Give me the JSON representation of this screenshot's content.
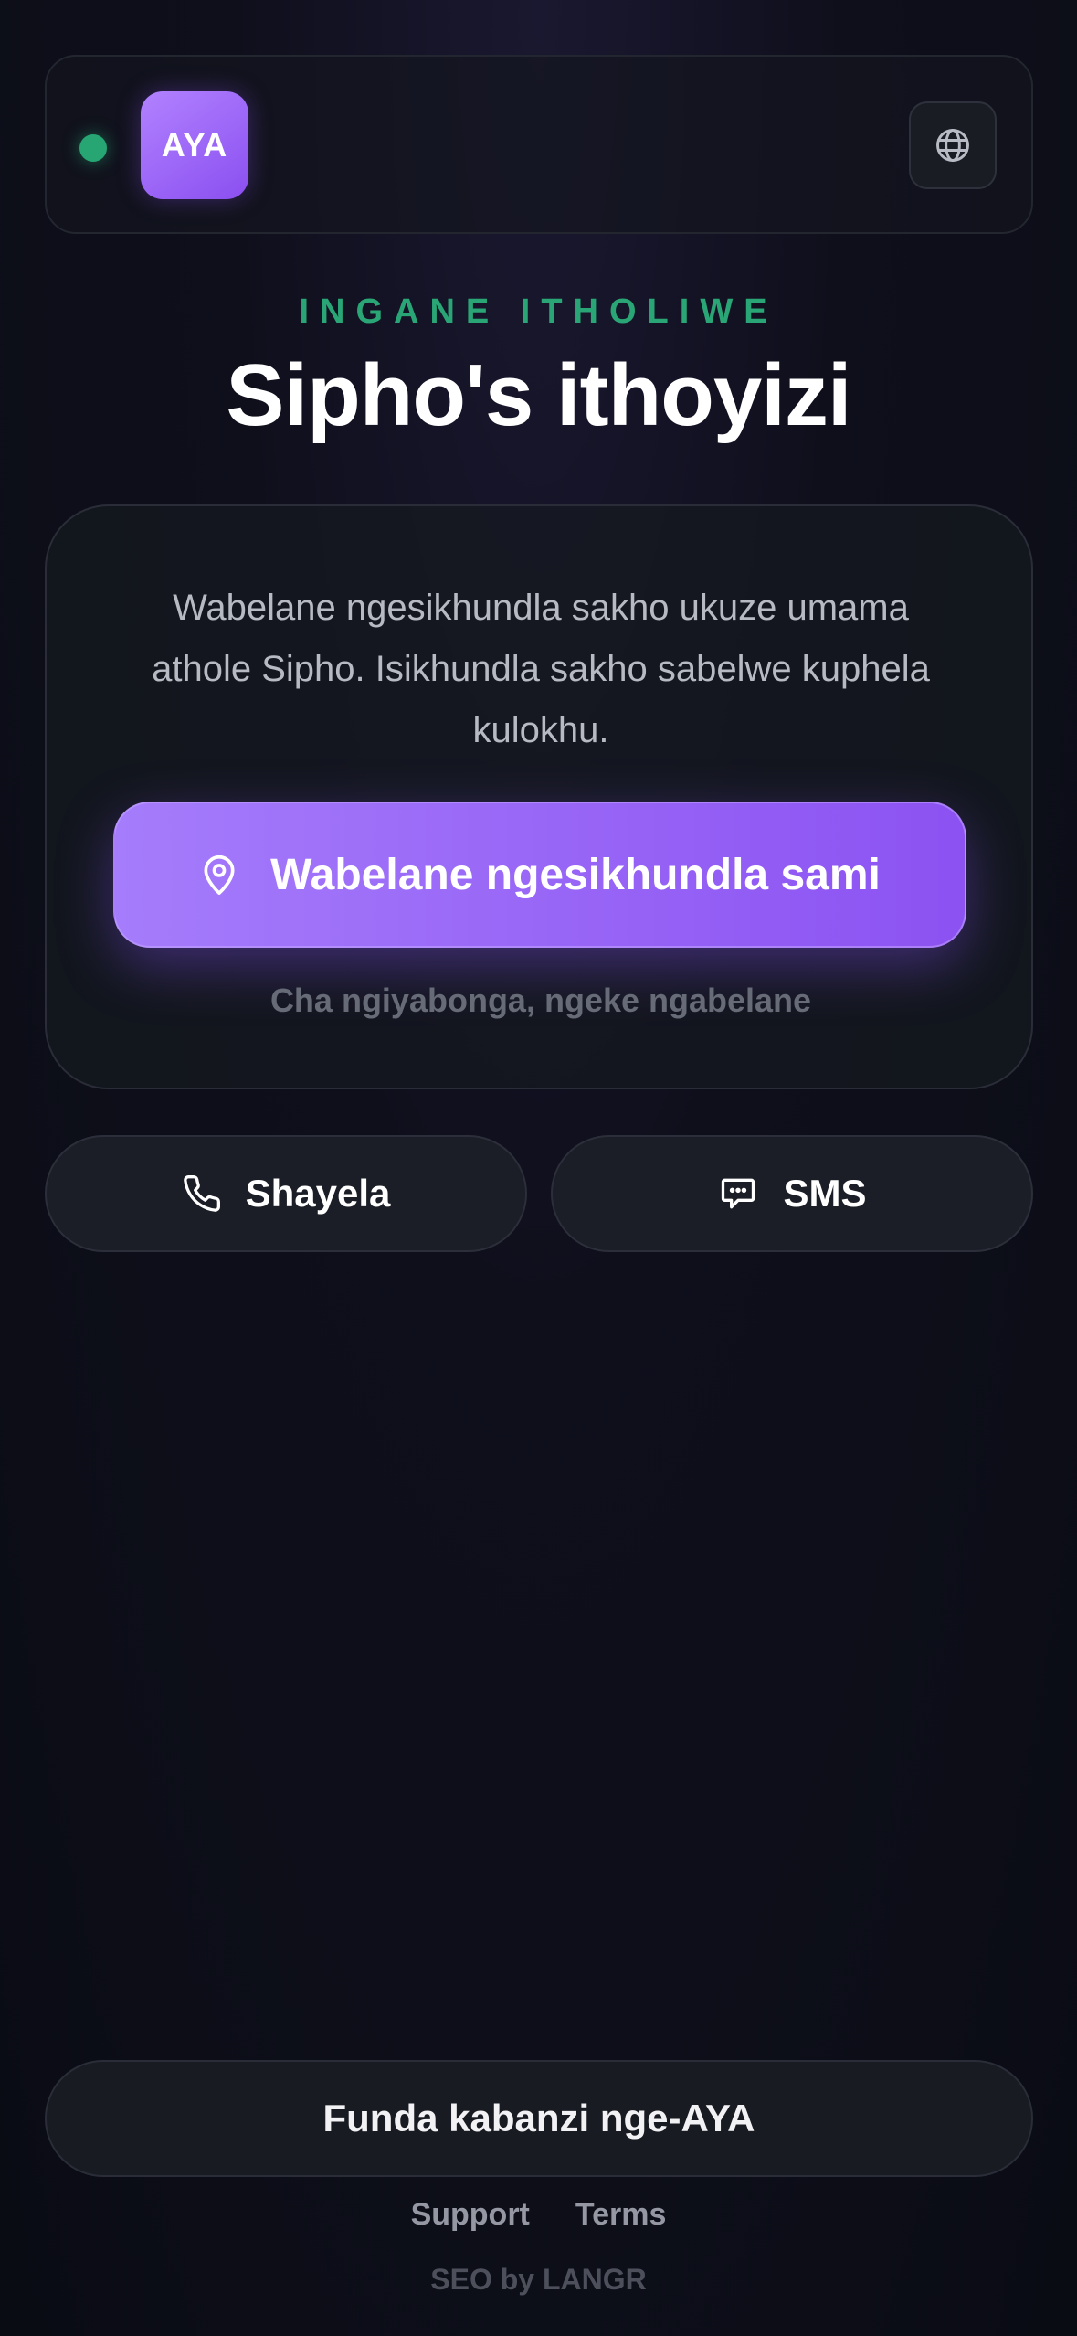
{
  "header": {
    "status": "online",
    "logo_text": "AYA",
    "language_icon": "globe-icon"
  },
  "hero": {
    "eyebrow": "INGANE ITHOLIWE",
    "title": "Sipho's ithoyizi"
  },
  "card": {
    "description": "Wabelane ngesikhundla sakho ukuze umama athole Sipho. Isikhundla sakho sabelwe kuphela kulokhu.",
    "share_button_label": "Wabelane ngesikhundla sami",
    "share_button_icon": "location-pin-icon",
    "decline_label": "Cha ngiyabonga, ngeke ngabelane"
  },
  "actions": {
    "call_label": "Shayela",
    "call_icon": "phone-icon",
    "sms_label": "SMS",
    "sms_icon": "chat-bubble-icon"
  },
  "footer": {
    "learn_more_label": "Funda kabanzi nge-AYA",
    "links": [
      "Support",
      "Terms"
    ],
    "credit": "SEO by LANGR"
  },
  "colors": {
    "accent_purple": "#8c52f2",
    "accent_green": "#2aa575",
    "background": "#0f0f1c"
  }
}
